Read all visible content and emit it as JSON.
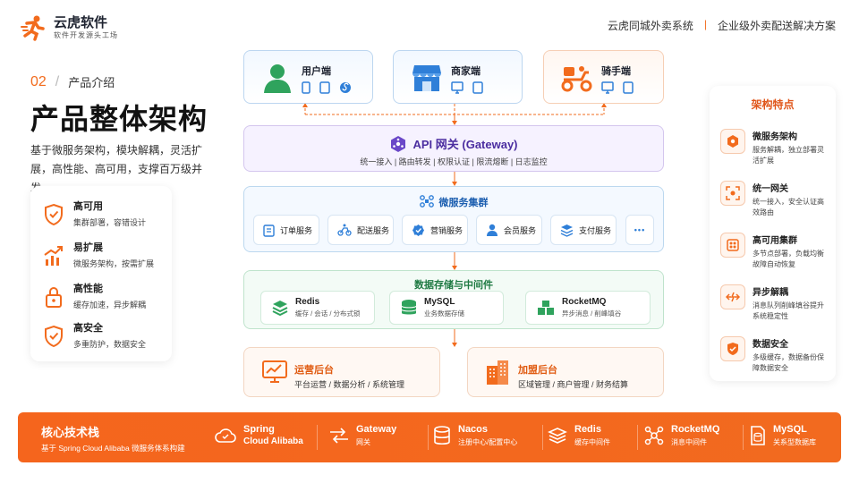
{
  "brand": {
    "name": "云虎软件",
    "sub": "软件开发源头工场"
  },
  "topbar": {
    "left": "云虎同城外卖系统",
    "sep": "|",
    "right": "企业级外卖配送解决方案"
  },
  "section": {
    "num": "02",
    "slash": "/",
    "label": "产品介绍"
  },
  "title": "产品整体架构",
  "desc": "基于微服务架构，模块解耦，灵活扩展，高性能、高可用，支撑百万级并发。",
  "features": [
    {
      "title": "高可用",
      "sub": "集群部署，容错设计",
      "icon": "shield-check-icon"
    },
    {
      "title": "易扩展",
      "sub": "微服务架构，按需扩展",
      "icon": "chart-up-icon"
    },
    {
      "title": "高性能",
      "sub": "缓存加速，异步解耦",
      "icon": "lock-icon"
    },
    {
      "title": "高安全",
      "sub": "多重防护，数据安全",
      "icon": "shield-check-icon"
    }
  ],
  "clients": [
    {
      "name": "用户端",
      "icon": "user-icon"
    },
    {
      "name": "商家端",
      "icon": "store-icon"
    },
    {
      "name": "骑手端",
      "icon": "scooter-icon"
    }
  ],
  "gateway": {
    "title": "API 网关 (Gateway)",
    "sub": "统一接入 | 路由转发 | 权限认证 | 限流熔断 | 日志监控"
  },
  "microservices": {
    "title": "微服务集群",
    "items": [
      "订单服务",
      "配送服务",
      "营销服务",
      "会员服务",
      "支付服务"
    ],
    "more": "•••"
  },
  "storage": {
    "title": "数据存储与中间件",
    "items": [
      {
        "name": "Redis",
        "sub": "缓存 / 会话 / 分布式锁"
      },
      {
        "name": "MySQL",
        "sub": "业务数据存储"
      },
      {
        "name": "RocketMQ",
        "sub": "异步消息 / 削峰填谷"
      }
    ]
  },
  "backends": [
    {
      "title": "运营后台",
      "sub": "平台运营 / 数据分析 / 系统管理"
    },
    {
      "title": "加盟后台",
      "sub": "区域管理 / 商户管理 / 财务结算"
    }
  ],
  "arch": {
    "title": "架构特点",
    "items": [
      {
        "title": "微服务架构",
        "sub": "服务解耦，独立部署灵活扩展"
      },
      {
        "title": "统一网关",
        "sub": "统一接入，安全认证高效路由"
      },
      {
        "title": "高可用集群",
        "sub": "多节点部署，负载均衡故障自动恢复"
      },
      {
        "title": "异步解耦",
        "sub": "消息队列削峰填谷提升系统稳定性"
      },
      {
        "title": "数据安全",
        "sub": "多级缓存，数据备份保障数据安全"
      }
    ]
  },
  "stack": {
    "title": "核心技术栈",
    "sub": "基于 Spring Cloud Alibaba 微服务体系构建",
    "items": [
      {
        "name": "Spring",
        "sub": "Cloud Alibaba",
        "icon": "cloud-icon"
      },
      {
        "name": "Gateway",
        "sub": "网关",
        "icon": "gateway-icon"
      },
      {
        "name": "Nacos",
        "sub": "注册中心/配置中心",
        "icon": "database-icon"
      },
      {
        "name": "Redis",
        "sub": "缓存中间件",
        "icon": "layers-icon"
      },
      {
        "name": "RocketMQ",
        "sub": "消息中间件",
        "icon": "nodes-icon"
      },
      {
        "name": "MySQL",
        "sub": "关系型数据库",
        "icon": "db-file-icon"
      }
    ]
  },
  "colors": {
    "accent": "#f26b1d",
    "gateway": "#6a47c8",
    "service": "#2f7fd8",
    "storage": "#2fa35d"
  }
}
